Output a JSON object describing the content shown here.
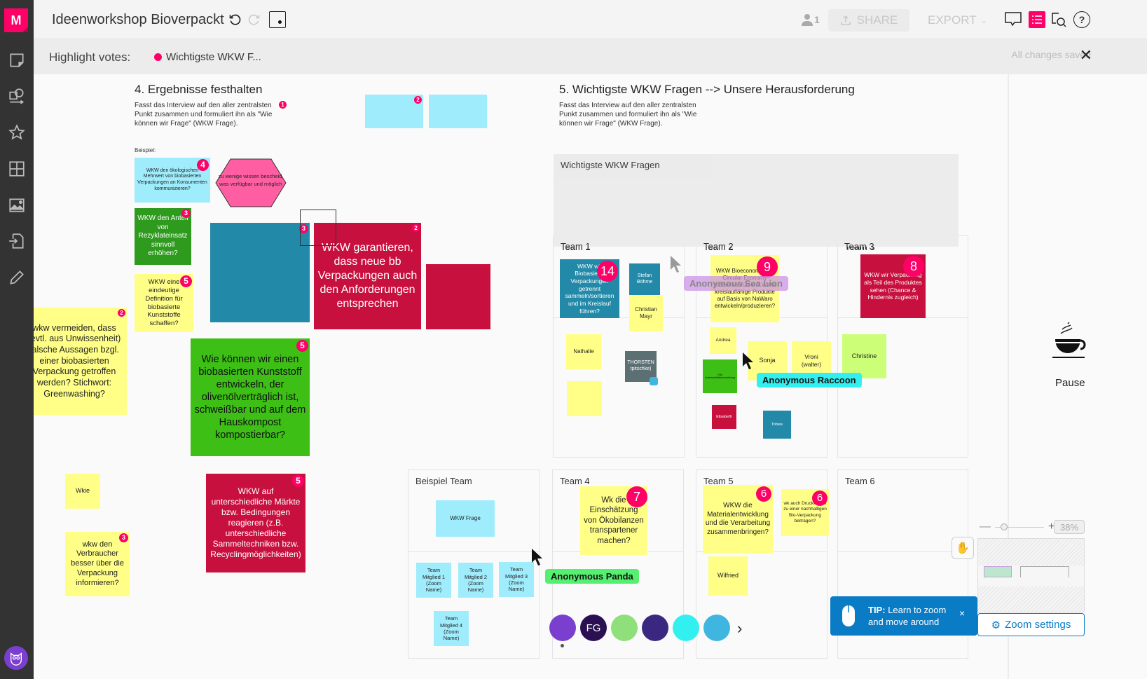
{
  "app": {
    "logo_letter": "M",
    "board_title": "Ideenworkshop Bioverpackt"
  },
  "sidebar": {
    "items": [
      {
        "name": "sticky-note-tool"
      },
      {
        "name": "shapes-tool"
      },
      {
        "name": "templates-tool"
      },
      {
        "name": "frame-tool"
      },
      {
        "name": "image-tool"
      },
      {
        "name": "import-tool"
      },
      {
        "name": "draw-tool"
      }
    ]
  },
  "topbar": {
    "user_count": "1",
    "share_label": "SHARE",
    "export_label": "EXPORT"
  },
  "votebar": {
    "label": "Highlight votes:",
    "chip_label": "Wichtigste WKW F...",
    "saved_status": "All changes saved"
  },
  "section4": {
    "title": "4. Ergebnisse festhalten",
    "desc": "Fasst das Interview auf den aller zentralsten Punkt zusammen und formuliert ihn als \"Wie können wir Frage\" (WKW Frage).",
    "desc_badge": "1",
    "beispiel": "Beispiel:"
  },
  "section5": {
    "title": "5. Wichtigste WKW Fragen --> Unsere Herausforderung",
    "desc": "Fasst das Interview auf den aller zentralsten Punkt zusammen und formuliert ihn als \"Wie können wir Frage\" (WKW Frage).",
    "gray_area_title": "Wichtigste WKW Fragen"
  },
  "notes": {
    "cyan_top1_badge": "2",
    "example_cyan": "WKW den ökologischen Mehrwert von biobasierten Verpackungen an Konsumenten kommunizieren?",
    "example_cyan_badge": "4",
    "hexagon": "zu wenige wissen bescheid, was verfügbar und möglich",
    "rezyklat": "WKW den Anteil von Rezyklateinsatz sinnvoll erhöhen?",
    "rezyklat_badge": "3",
    "definition": "WKW eine eindeutige Definition für biobasierte Kunststoffe schaffen?",
    "definition_badge": "5",
    "greenwashing": "wkw vermeiden, dass (evtl. aus Unwissenheit) falsche Aussagen bzgl. einer biobasierten Verpackung getroffen werden? Stichwort: Greenwashing?",
    "greenwashing_badge": "2",
    "teal_big_badge": "3",
    "garantieren": "WKW garantieren, dass neue bb Verpackungen auch den Anforderungen entsprechen",
    "garantieren_badge": "2",
    "olivenoel": "Wie können wir einen biobasierten Kunststoff entwickeln, der olivenölverträglich ist, schweißbar und auf dem Hauskompost kompostierbar?",
    "olivenoel_badge": "5",
    "wkie": "Wkie",
    "verbraucher": "wkw den Verbraucher besser über die Verpackung informieren?",
    "verbraucher_badge": "3",
    "maerkte": "WKW auf unterschiedliche Märkte bzw. Bedingungen reagieren (z.B. unterschiedliche Sammeltechniken bzw. Recyclingmöglichkeiten)",
    "maerkte_badge": "5"
  },
  "teams": [
    {
      "title": "Team 1",
      "question": "WKW wir Biobasierte Verpackungen getrennt sammeln/sortieren und im Kreislauf führen?",
      "badge": "14",
      "members": [
        "Stefan Böhme",
        "Christian Mayr",
        "Nathalie",
        "",
        "THORSTEN tpitschke)"
      ]
    },
    {
      "title": "Team 2",
      "question": "WKW Bioeconomy und Circular Economy zusammenführen? WKW kreislauffähige Produkte auf Basis von NaWaro entwickeln/produzieren?",
      "badge": "9",
      "members": [
        "Andrea",
        "Sonja",
        "Vroni (walter)",
        "Falk Lebensmittelkennzeichnung",
        "Elisabeth",
        "Tobias"
      ]
    },
    {
      "title": "Team 3",
      "question": "WKW wir Verpackung als Teil des Produktes sehen (Chance & Hindernis zugleich)",
      "badge": "8",
      "members": [
        "Christine"
      ]
    },
    {
      "title": "Team 4",
      "question": "Wk die Einschätzung von Ökobilanzen transpartener machen?",
      "badge": "7",
      "members": []
    },
    {
      "title": "Team 5",
      "question": "WKW die Materialentwicklung und die Verarbeitung zusammenbringen?",
      "badge": "6",
      "question2": "wk auch Druckfarben zu einer nachhaltigen Bio-Verpackung beitragen?",
      "badge2": "6",
      "members": [
        "Wilfried"
      ]
    },
    {
      "title": "Team 6",
      "members": []
    }
  ],
  "beispiel_team": {
    "title": "Beispiel Team",
    "question": "WKW Frage",
    "members": [
      "Team Mitglied 1 (Zoom Name)",
      "Team Mitglied 2 (Zoom Name)",
      "Team Mitglied 3 (Zoom Name)",
      "Team Mitglied 4 (Zoom Name)"
    ]
  },
  "cursors": {
    "sea_lion": "Anonymous Sea Lion",
    "raccoon": "Anonymous Raccoon",
    "panda": "Anonymous Panda"
  },
  "pause": {
    "label": "Pause"
  },
  "participants": [
    {
      "name": "owl",
      "color": "#7b3fd0",
      "text": ""
    },
    {
      "name": "fg",
      "color": "#2a0f52",
      "text": "FG"
    },
    {
      "name": "koala",
      "color": "#8fe07a",
      "text": ""
    },
    {
      "name": "spider",
      "color": "#3a2880",
      "text": ""
    },
    {
      "name": "raccoon",
      "color": "#33f0f0",
      "text": ""
    },
    {
      "name": "lion",
      "color": "#3fb6e0",
      "text": ""
    }
  ],
  "zoom": {
    "percent": "38%",
    "settings_label": "Zoom settings",
    "tip_bold": "TIP:",
    "tip_text": "Learn to zoom and move around"
  },
  "colors": {
    "accent": "#ff0066",
    "tip_blue": "#0a7cc6"
  }
}
